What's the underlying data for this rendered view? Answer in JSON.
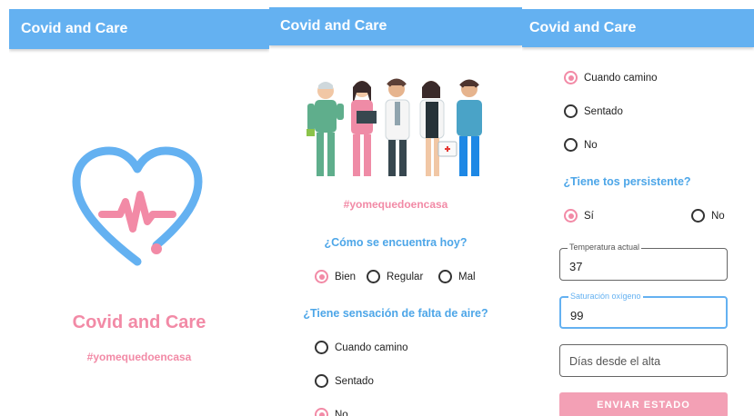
{
  "app": {
    "title": "Covid and Care"
  },
  "splash": {
    "name": "Covid and Care",
    "hashtag": "#yomequedoencasa",
    "logo_icon": "heart-pulse-icon",
    "colors": {
      "heart": "#64b1f1",
      "pulse": "#f28aa6"
    }
  },
  "form1": {
    "illustration": "medical-team-illustration",
    "hashtag": "#yomequedoencasa",
    "q1": {
      "question": "¿Cómo se encuentra hoy?",
      "options": [
        "Bien",
        "Regular",
        "Mal"
      ],
      "selected": "Bien"
    },
    "q2": {
      "question": "¿Tiene sensación de falta de aire?",
      "options": [
        "Cuando camino",
        "Sentado",
        "No"
      ],
      "selected": "No"
    }
  },
  "form2": {
    "q2_options": [
      "Cuando camino",
      "Sentado",
      "No"
    ],
    "q2_selected": "Cuando camino",
    "q3": {
      "question": "¿Tiene tos persistente?",
      "options": [
        "Sí",
        "No"
      ],
      "selected": "Sí"
    },
    "temperature": {
      "label": "Temperatura actual",
      "value": "37"
    },
    "saturation": {
      "label": "Saturación oxígeno",
      "value": "99"
    },
    "days": {
      "placeholder": "Días desde el alta"
    },
    "submit_label": "ENVIAR ESTADO"
  },
  "colors": {
    "appbar": "#64b1f1",
    "accent_pink": "#f28aa6",
    "question_blue": "#4da6e8"
  }
}
